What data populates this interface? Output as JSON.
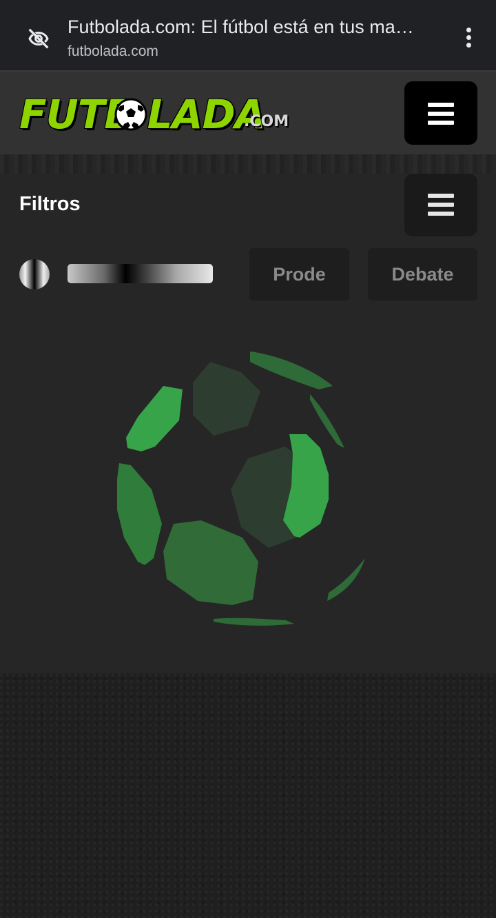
{
  "browser": {
    "title": "Futbolada.com: El fútbol está en tus ma…",
    "url": "futbolada.com",
    "eye_icon": "eye-off-icon",
    "menu_icon": "more-vert-icon"
  },
  "header": {
    "logo_text": "FUTB LADA",
    "logo_suffix": ".COM",
    "menu_icon": "hamburger-icon",
    "colors": {
      "logo_green": "#8ed400",
      "header_bg": "#323232"
    }
  },
  "filters": {
    "title": "Filtros",
    "menu_icon": "hamburger-icon",
    "buttons": [
      {
        "label": "Prode"
      },
      {
        "label": "Debate"
      }
    ]
  },
  "loader": {
    "icon": "soccer-ball-icon",
    "colors": {
      "bright_green": "#38a44a",
      "mid_green": "#2f6b38",
      "dark_green": "#2d3d2f"
    }
  }
}
